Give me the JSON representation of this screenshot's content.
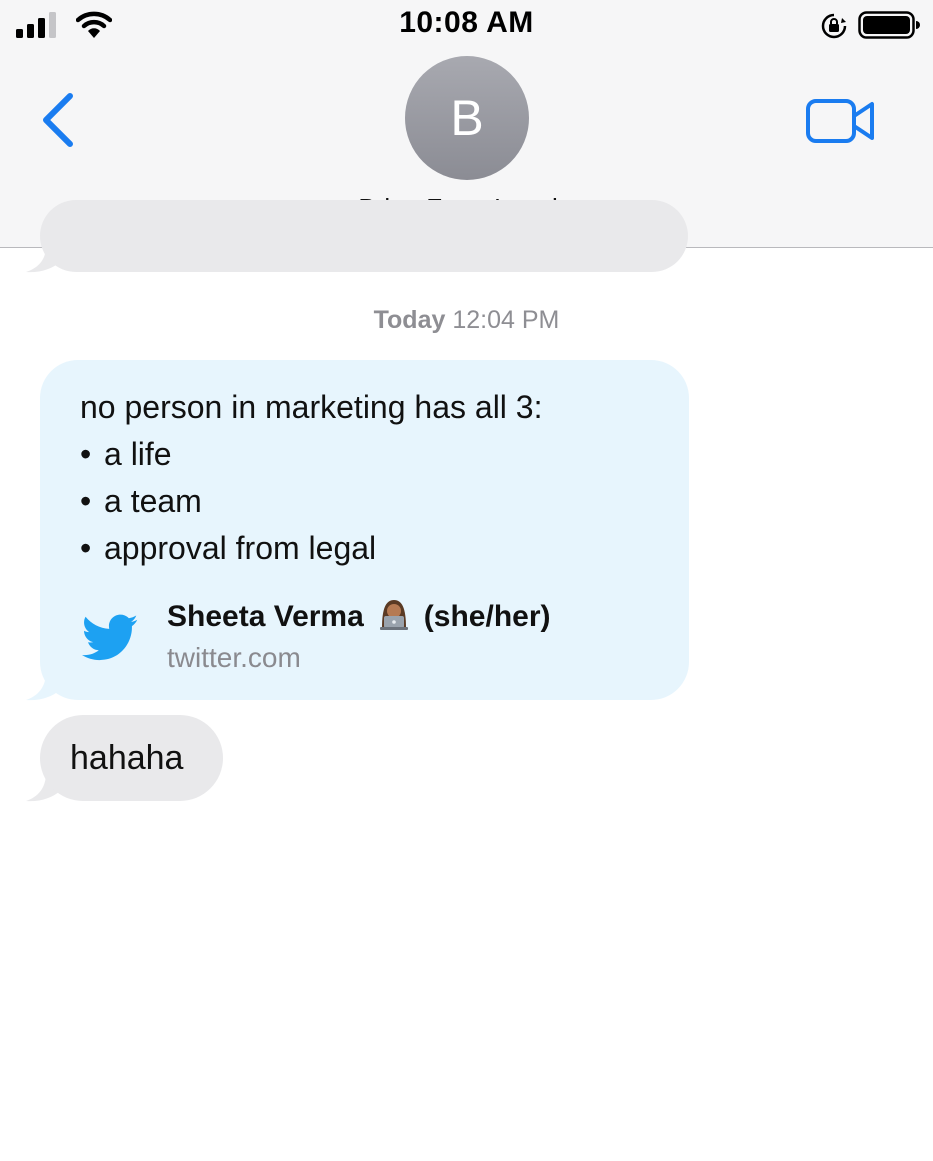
{
  "status_bar": {
    "time": "10:08 AM",
    "icons": [
      "cellular-signal-icon",
      "wifi-icon",
      "orientation-lock-icon",
      "battery-icon"
    ]
  },
  "nav": {
    "back_icon": "chevron-left-icon",
    "video_icon": "video-camera-icon",
    "avatar_initial": "B",
    "contact_name": "Brian From Legal",
    "contact_chevron": ">"
  },
  "conversation": {
    "timestamp_day": "Today",
    "timestamp_time": "12:04 PM",
    "link_message": {
      "intro": "no person in marketing has all 3:",
      "bullet_char": "•",
      "bullets": [
        "a life",
        "a team",
        "approval from legal"
      ],
      "preview_title_name": "Sheeta Verma",
      "preview_title_pronouns": "(she/her)",
      "preview_emoji": "woman-technologist-emoji",
      "preview_domain": "twitter.com",
      "preview_icon": "twitter-bird-icon"
    },
    "reply_message": "hahaha"
  },
  "colors": {
    "ios_blue": "#1a7cf0",
    "twitter_blue": "#1da1f2",
    "received_bubble": "#e9e9eb",
    "link_bubble": "#e7f5fd",
    "header_bg": "#f6f6f7"
  }
}
